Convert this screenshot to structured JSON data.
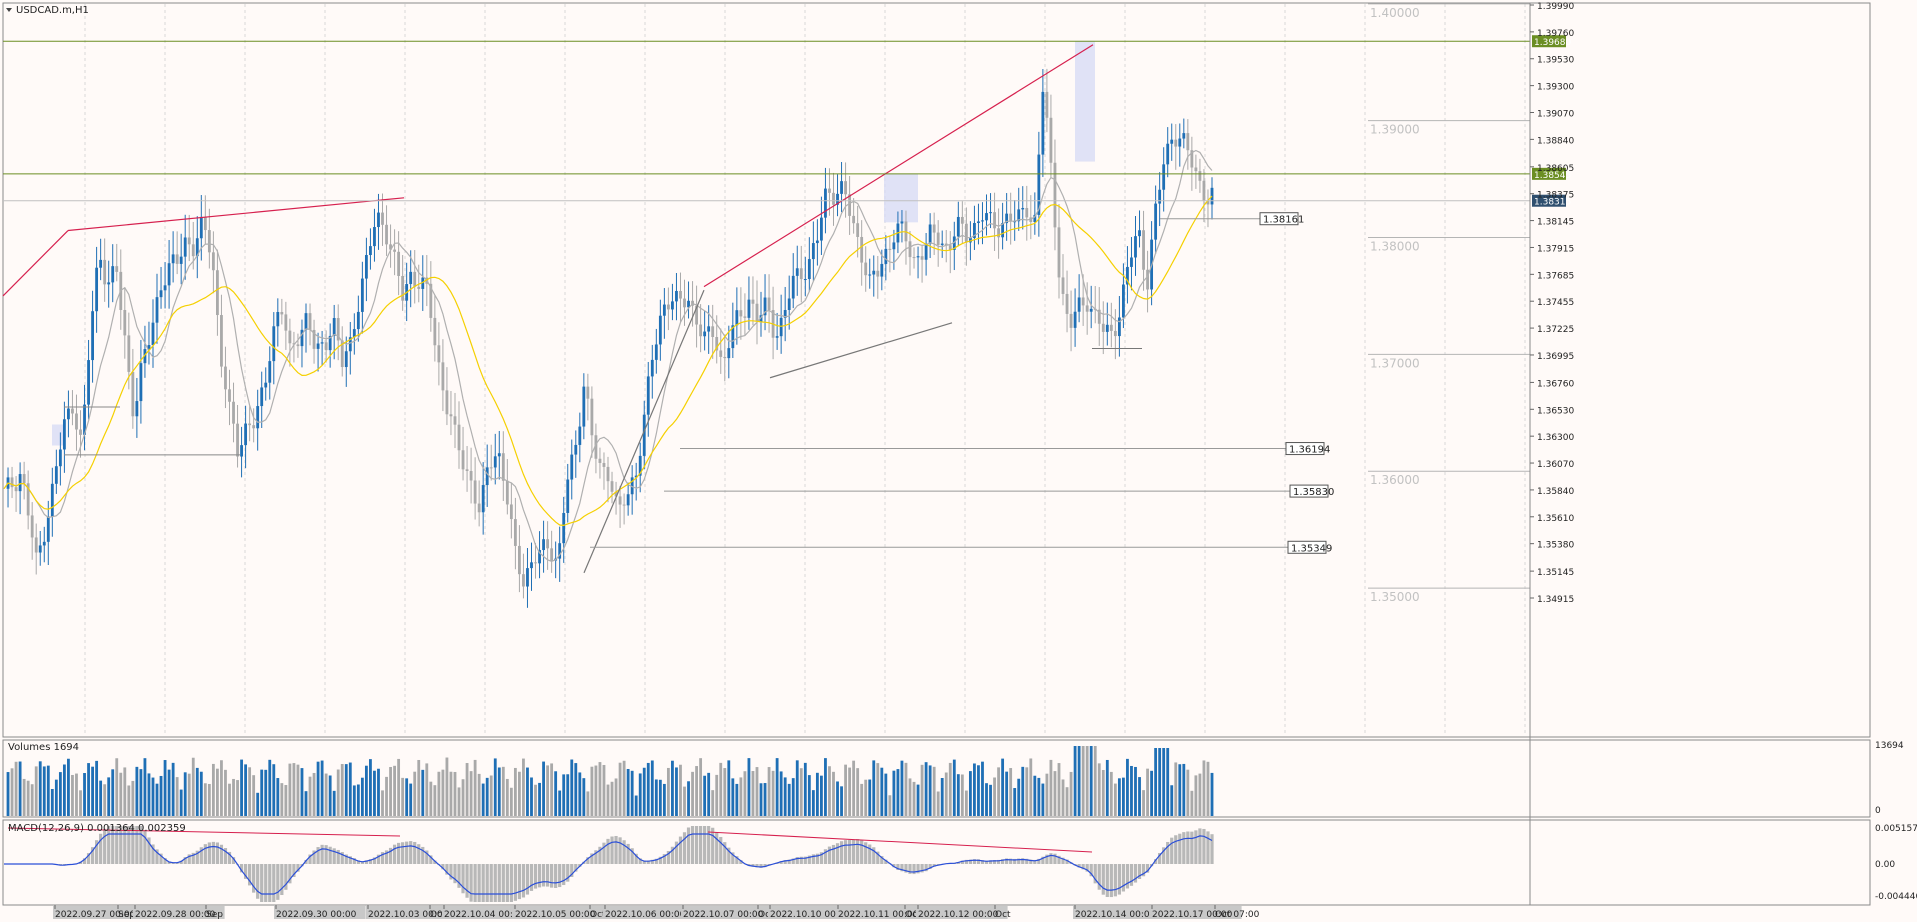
{
  "chart_data": {
    "type": "candlestick",
    "symbol_title": "USDCAD.m,H1",
    "price_axis": {
      "range": [
        1.34915,
        1.3999
      ],
      "tick_labels": [
        "1.39990",
        "1.39760",
        "1.39530",
        "1.39300",
        "1.39070",
        "1.38840",
        "1.38605",
        "1.38375",
        "1.38145",
        "1.37915",
        "1.37685",
        "1.37455",
        "1.37225",
        "1.36995",
        "1.36760",
        "1.36530",
        "1.36300",
        "1.36070",
        "1.35840",
        "1.35610",
        "1.35380",
        "1.35145",
        "1.34915"
      ],
      "round_levels": [
        {
          "value": 1.4,
          "label": "1.40000"
        },
        {
          "value": 1.39,
          "label": "1.39000"
        },
        {
          "value": 1.38,
          "label": "1.38000"
        },
        {
          "value": 1.37,
          "label": "1.37000"
        },
        {
          "value": 1.36,
          "label": "1.36000"
        },
        {
          "value": 1.35,
          "label": "1.35000"
        }
      ]
    },
    "horizontal_lines": [
      {
        "value": 1.3968,
        "label": "1.39680",
        "color": "#6b8e23"
      },
      {
        "value": 1.38545,
        "label": "1.38545",
        "color": "#6b8e23"
      },
      {
        "value": 1.38315,
        "label": "1.38315",
        "color": "#2f4f6f"
      }
    ],
    "price_tags": [
      {
        "value": 1.38161,
        "label": "1.38161"
      },
      {
        "value": 1.36194,
        "label": "1.36194"
      },
      {
        "value": 1.3583,
        "label": "1.35830"
      },
      {
        "value": 1.35349,
        "label": "1.35349"
      }
    ],
    "series": [
      {
        "name": "close",
        "points": [
          [
            0,
            1.358
          ],
          [
            8,
            1.36
          ],
          [
            15,
            1.352
          ],
          [
            22,
            1.358
          ],
          [
            28,
            1.364
          ],
          [
            32,
            1.366
          ],
          [
            36,
            1.362
          ],
          [
            40,
            1.372
          ],
          [
            44,
            1.379
          ],
          [
            48,
            1.376
          ],
          [
            52,
            1.377
          ],
          [
            56,
            1.371
          ],
          [
            60,
            1.365
          ],
          [
            64,
            1.369
          ],
          [
            68,
            1.372
          ],
          [
            72,
            1.376
          ],
          [
            76,
            1.377
          ],
          [
            80,
            1.378
          ],
          [
            84,
            1.38
          ],
          [
            88,
            1.379
          ],
          [
            92,
            1.381
          ],
          [
            96,
            1.379
          ],
          [
            100,
            1.37
          ],
          [
            104,
            1.365
          ],
          [
            108,
            1.362
          ],
          [
            112,
            1.364
          ],
          [
            116,
            1.364
          ],
          [
            120,
            1.367
          ],
          [
            124,
            1.372
          ],
          [
            128,
            1.374
          ],
          [
            132,
            1.37
          ],
          [
            136,
            1.372
          ],
          [
            140,
            1.373
          ],
          [
            144,
            1.37
          ],
          [
            148,
            1.371
          ],
          [
            152,
            1.373
          ],
          [
            156,
            1.369
          ],
          [
            160,
            1.371
          ],
          [
            164,
            1.375
          ],
          [
            168,
            1.378
          ],
          [
            172,
            1.382
          ],
          [
            176,
            1.381
          ],
          [
            180,
            1.378
          ],
          [
            184,
            1.375
          ],
          [
            188,
            1.377
          ],
          [
            192,
            1.376
          ],
          [
            196,
            1.375
          ],
          [
            200,
            1.37
          ],
          [
            204,
            1.366
          ],
          [
            208,
            1.363
          ],
          [
            212,
            1.361
          ],
          [
            216,
            1.359
          ],
          [
            220,
            1.356
          ],
          [
            224,
            1.361
          ],
          [
            228,
            1.362
          ],
          [
            232,
            1.358
          ],
          [
            236,
            1.353
          ],
          [
            240,
            1.351
          ],
          [
            244,
            1.352
          ],
          [
            248,
            1.353
          ],
          [
            252,
            1.354
          ],
          [
            256,
            1.352
          ],
          [
            260,
            1.359
          ],
          [
            264,
            1.362
          ],
          [
            268,
            1.368
          ],
          [
            272,
            1.362
          ],
          [
            276,
            1.36
          ],
          [
            280,
            1.36
          ],
          [
            284,
            1.356
          ],
          [
            288,
            1.358
          ],
          [
            292,
            1.36
          ],
          [
            296,
            1.365
          ],
          [
            300,
            1.37
          ],
          [
            304,
            1.374
          ],
          [
            308,
            1.375
          ],
          [
            312,
            1.374
          ],
          [
            316,
            1.375
          ],
          [
            320,
            1.373
          ],
          [
            324,
            1.371
          ],
          [
            328,
            1.372
          ],
          [
            332,
            1.369
          ],
          [
            336,
            1.372
          ],
          [
            340,
            1.373
          ],
          [
            344,
            1.375
          ],
          [
            348,
            1.373
          ],
          [
            352,
            1.374
          ],
          [
            356,
            1.372
          ],
          [
            360,
            1.373
          ],
          [
            364,
            1.376
          ],
          [
            368,
            1.377
          ],
          [
            372,
            1.378
          ],
          [
            376,
            1.38
          ],
          [
            380,
            1.384
          ],
          [
            384,
            1.384
          ],
          [
            388,
            1.384
          ],
          [
            392,
            1.381
          ],
          [
            396,
            1.379
          ],
          [
            400,
            1.376
          ],
          [
            404,
            1.377
          ],
          [
            408,
            1.379
          ],
          [
            412,
            1.381
          ],
          [
            416,
            1.38
          ],
          [
            420,
            1.378
          ],
          [
            424,
            1.379
          ],
          [
            428,
            1.38
          ],
          [
            432,
            1.38
          ],
          [
            436,
            1.379
          ],
          [
            440,
            1.381
          ],
          [
            444,
            1.38
          ],
          [
            448,
            1.381
          ],
          [
            452,
            1.382
          ],
          [
            456,
            1.381
          ],
          [
            460,
            1.381
          ],
          [
            464,
            1.382
          ],
          [
            468,
            1.381
          ],
          [
            472,
            1.383
          ],
          [
            476,
            1.381
          ],
          [
            480,
            1.393
          ],
          [
            484,
            1.385
          ],
          [
            488,
            1.376
          ],
          [
            492,
            1.372
          ],
          [
            496,
            1.374
          ],
          [
            500,
            1.375
          ],
          [
            504,
            1.373
          ],
          [
            508,
            1.372
          ],
          [
            512,
            1.372
          ],
          [
            516,
            1.374
          ],
          [
            520,
            1.378
          ],
          [
            524,
            1.381
          ],
          [
            528,
            1.376
          ],
          [
            532,
            1.382
          ],
          [
            536,
            1.387
          ],
          [
            540,
            1.389
          ],
          [
            544,
            1.388
          ],
          [
            548,
            1.387
          ],
          [
            552,
            1.385
          ],
          [
            556,
            1.383
          ],
          [
            558,
            1.38315
          ]
        ]
      }
    ],
    "indicators": {
      "volumes": {
        "label": "Volumes 1694",
        "max_label": "13694",
        "min_label": "0"
      },
      "macd": {
        "label": "MACD(12,26,9) 0.001364 0.002359",
        "max_label": "0.005157",
        "zero_label": "0.00",
        "min_label": "-0.004446"
      }
    },
    "time_axis_labels": [
      "2022.09.27 00:00",
      "Sep",
      "2022.09.28 00:00",
      "Sep",
      "2022.09.30 00:00",
      "2022.10.03 00:00",
      "Oct",
      "2022.10.04 00:00",
      "2022.10.05 00:00",
      "Oct",
      "2022.10.06 00:00",
      "2022.10.07 00:00",
      "Oct",
      "2022.10.10 00:00",
      "2022.10.11 00:00",
      "Oct",
      "2022.10.12 00:00",
      "Oct",
      "2022.10.14 00:00",
      "2022.10.17 00:00",
      "Oct 07:00"
    ],
    "colors": {
      "bull": "#1f6fb5",
      "bear": "#a9a9a9",
      "ma_fast": "#b0b0b0",
      "ma_slow": "#f5d000",
      "trendline": "#d6204e",
      "level": "#6b8e23",
      "macd_line": "#2b4fd8",
      "macd_hist": "#b8b8b8"
    }
  }
}
